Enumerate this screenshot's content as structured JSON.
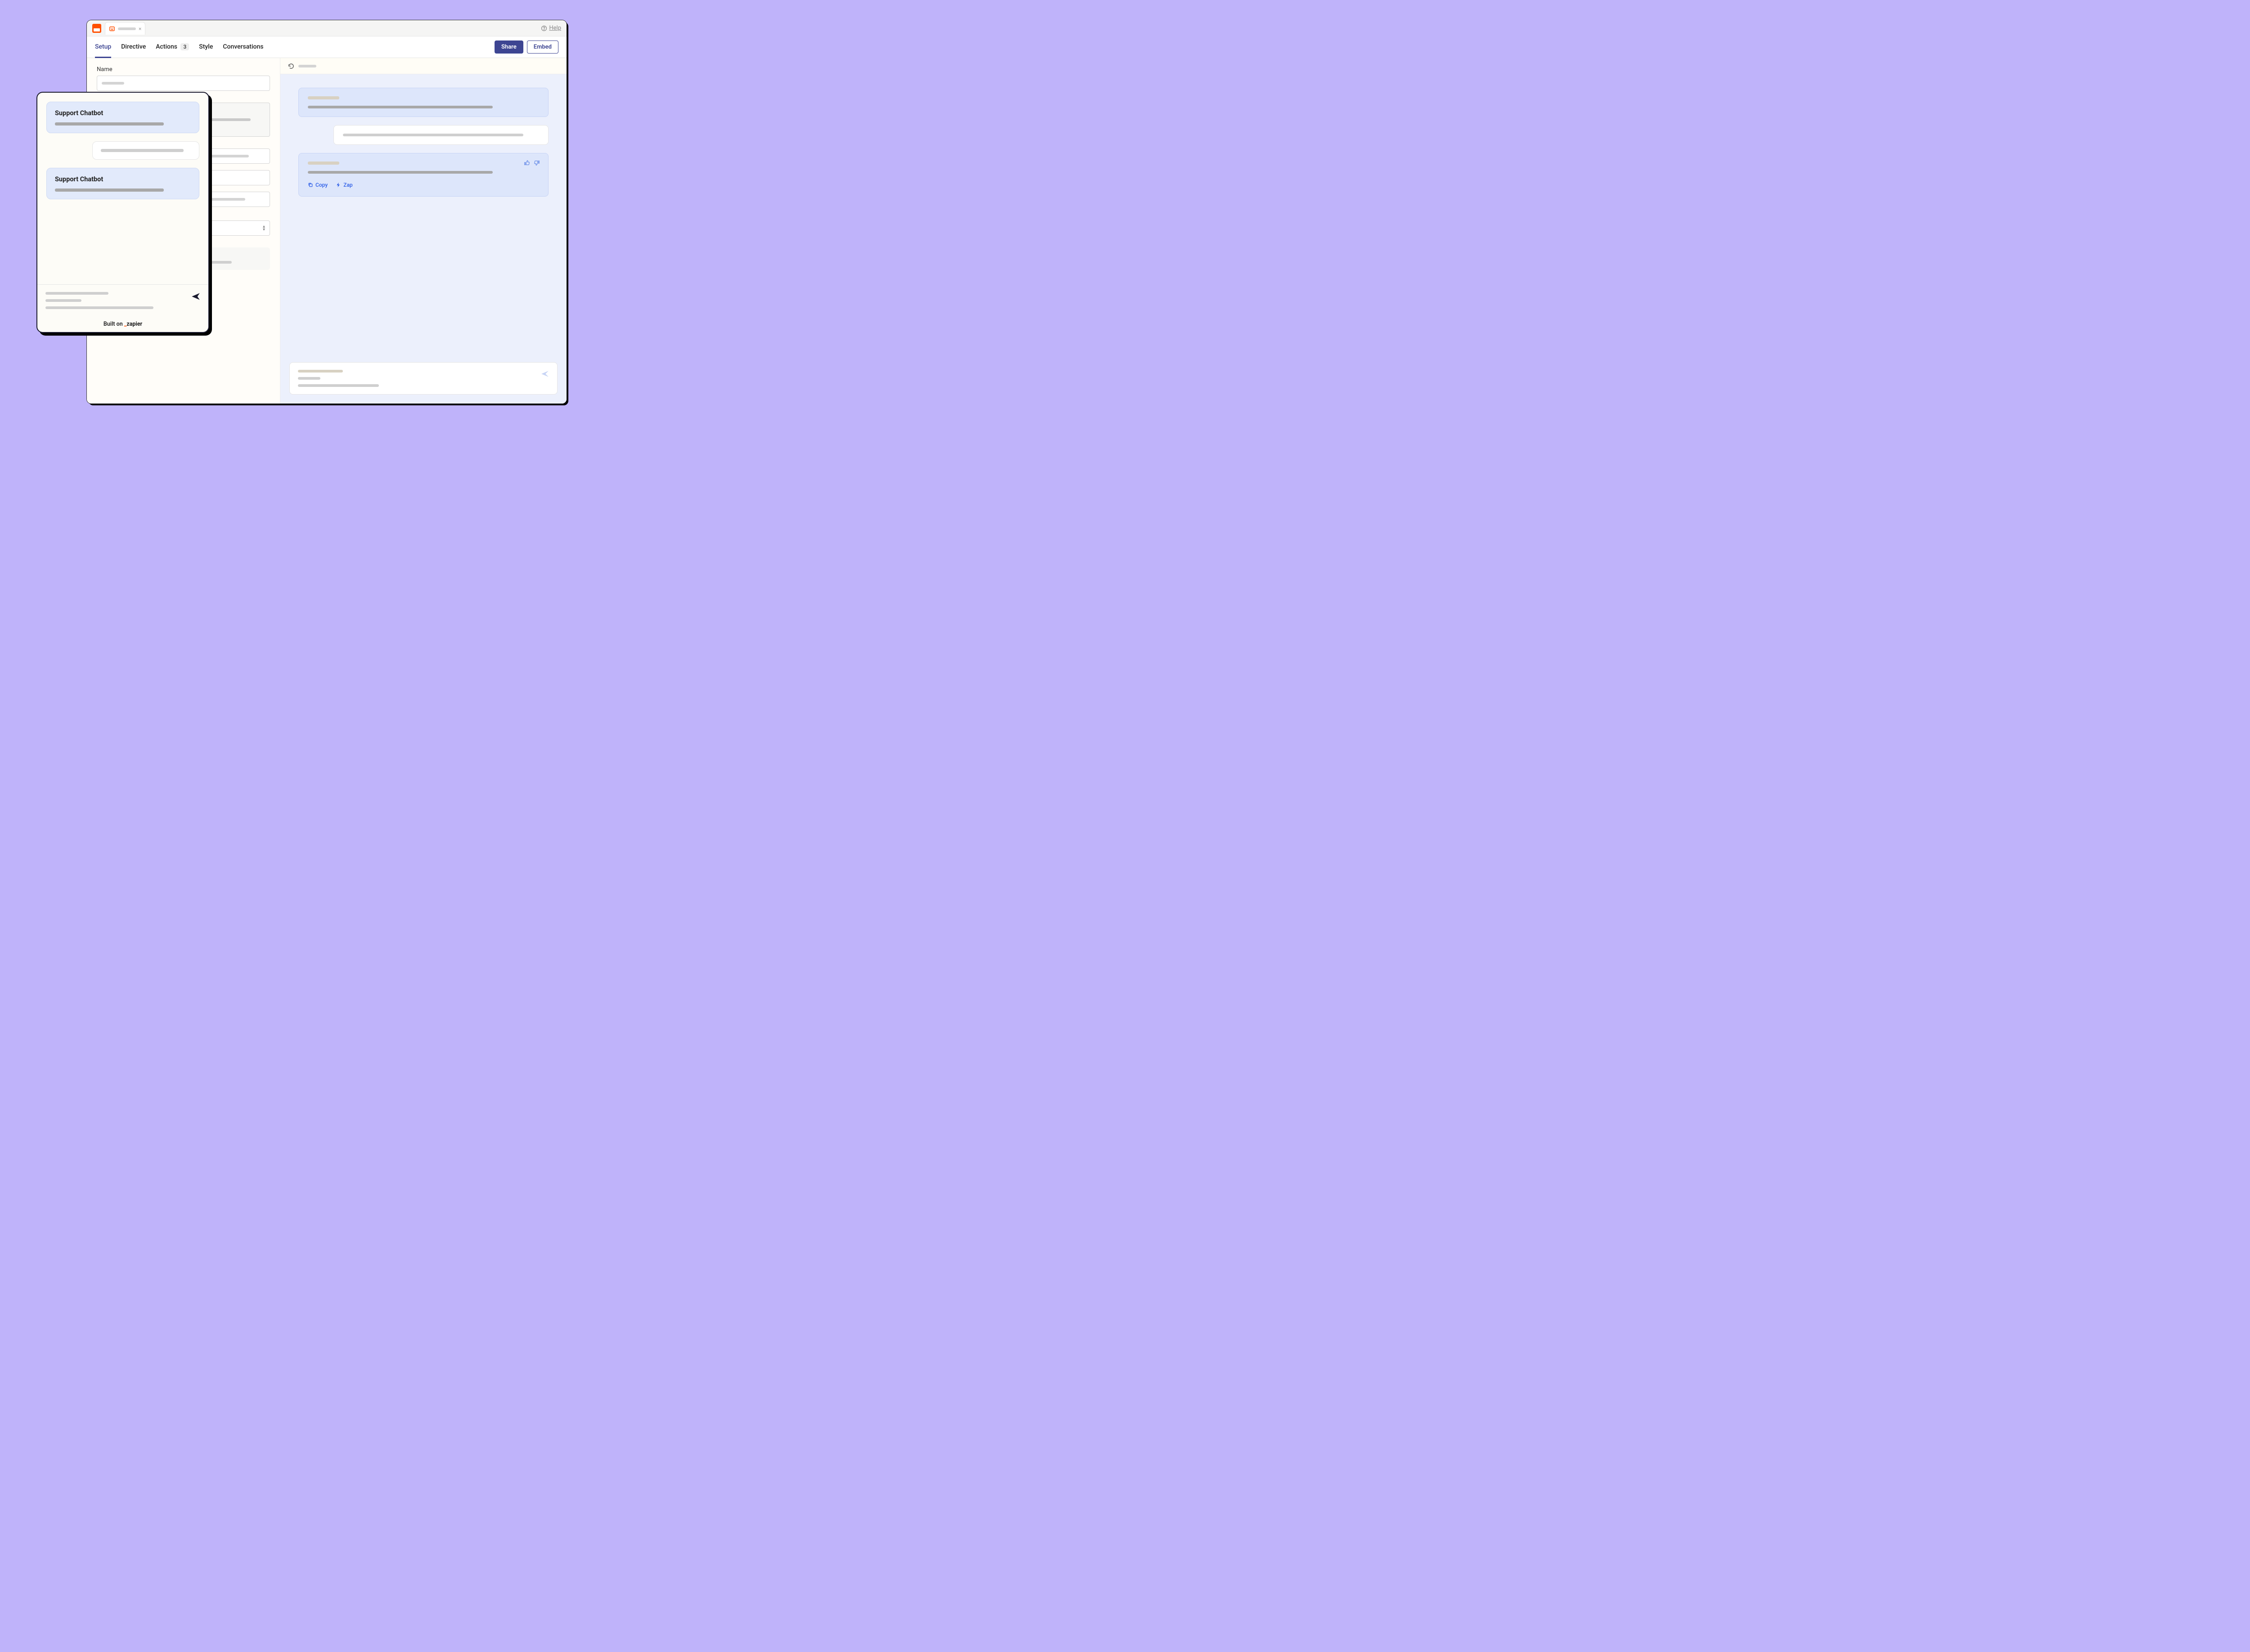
{
  "titlebar": {
    "help": "Help"
  },
  "nav": {
    "setup": "Setup",
    "directive": "Directive",
    "actions": "Actions",
    "actions_badge": "3",
    "style": "Style",
    "conversations": "Conversations",
    "share": "Share",
    "embed": "Embed"
  },
  "form": {
    "name_label": "Name"
  },
  "preview": {
    "copy": "Copy",
    "zap": "Zap"
  },
  "widget": {
    "bot_name": "Support Chatbot",
    "built_on": "Built on",
    "brand": "zapier"
  }
}
